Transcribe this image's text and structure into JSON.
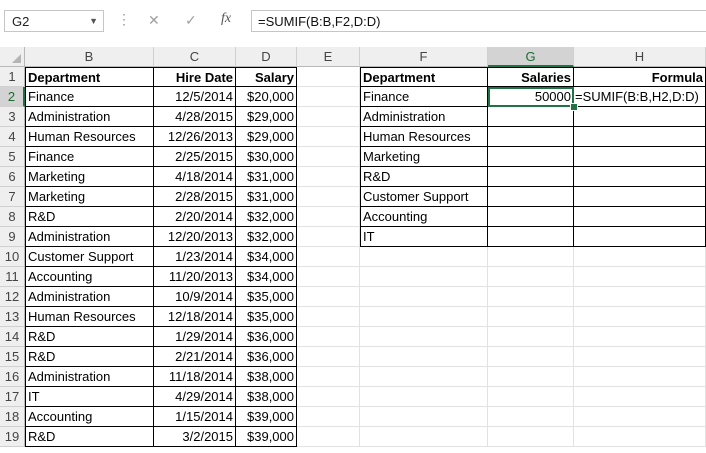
{
  "formula_bar": {
    "name_box": "G2",
    "cancel_icon": "✕",
    "enter_icon": "✓",
    "fx_label": "fx",
    "formula": "=SUMIF(B:B,F2,D:D)"
  },
  "columns": [
    "B",
    "C",
    "D",
    "E",
    "F",
    "G",
    "H"
  ],
  "rows": [
    "1",
    "2",
    "3",
    "4",
    "5",
    "6",
    "7",
    "8",
    "9",
    "10",
    "11",
    "12",
    "13",
    "14",
    "15",
    "16",
    "17",
    "18",
    "19"
  ],
  "table": {
    "headers": [
      "Department",
      "Hire Date",
      "Salary"
    ],
    "rows": [
      [
        "Finance",
        "12/5/2014",
        "$20,000"
      ],
      [
        "Administration",
        "4/28/2015",
        "$29,000"
      ],
      [
        "Human Resources",
        "12/26/2013",
        "$29,000"
      ],
      [
        "Finance",
        "2/25/2015",
        "$30,000"
      ],
      [
        "Marketing",
        "4/18/2014",
        "$31,000"
      ],
      [
        "Marketing",
        "2/28/2015",
        "$31,000"
      ],
      [
        "R&D",
        "2/20/2014",
        "$32,000"
      ],
      [
        "Administration",
        "12/20/2013",
        "$32,000"
      ],
      [
        "Customer Support",
        "1/23/2014",
        "$34,000"
      ],
      [
        "Accounting",
        "11/20/2013",
        "$34,000"
      ],
      [
        "Administration",
        "10/9/2014",
        "$35,000"
      ],
      [
        "Human Resources",
        "12/18/2014",
        "$35,000"
      ],
      [
        "R&D",
        "1/29/2014",
        "$36,000"
      ],
      [
        "R&D",
        "2/21/2014",
        "$36,000"
      ],
      [
        "Administration",
        "11/18/2014",
        "$38,000"
      ],
      [
        "IT",
        "4/29/2014",
        "$38,000"
      ],
      [
        "Accounting",
        "1/15/2014",
        "$39,000"
      ],
      [
        "R&D",
        "3/2/2015",
        "$39,000"
      ]
    ]
  },
  "summary": {
    "headers": [
      "Department",
      "Salaries",
      "Formula"
    ],
    "rows": [
      [
        "Finance",
        "50000",
        "=SUMIF(B:B,H2,D:D)"
      ],
      [
        "Administration",
        "",
        ""
      ],
      [
        "Human Resources",
        "",
        ""
      ],
      [
        "Marketing",
        "",
        ""
      ],
      [
        "R&D",
        "",
        ""
      ],
      [
        "Customer Support",
        "",
        ""
      ],
      [
        "Accounting",
        "",
        ""
      ],
      [
        "IT",
        "",
        ""
      ]
    ]
  },
  "selection": {
    "cell": "G2",
    "column": "G",
    "row": "2"
  },
  "colors": {
    "accent": "#217346",
    "header_bg": "#efefef",
    "selected_header_bg": "#d3d3d3"
  }
}
